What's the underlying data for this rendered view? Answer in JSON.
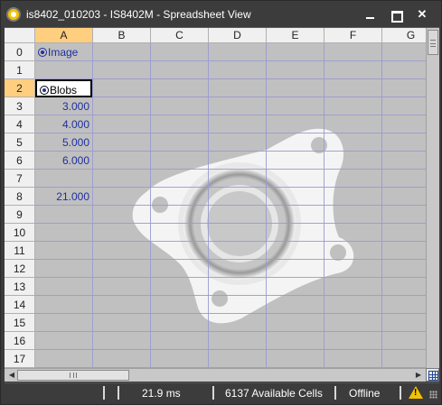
{
  "window": {
    "title": "is8402_010203 - IS8402M - Spreadsheet View"
  },
  "columns": [
    "A",
    "B",
    "C",
    "D",
    "E",
    "F",
    "G"
  ],
  "selected_column": "A",
  "rows": [
    "0",
    "1",
    "2",
    "3",
    "4",
    "5",
    "6",
    "7",
    "8",
    "9",
    "10",
    "11",
    "12",
    "13",
    "14",
    "15",
    "16",
    "17"
  ],
  "selected_row": "2",
  "cells": {
    "A0": "Image",
    "A2": "Blobs",
    "A3": "3.000",
    "A4": "4.000",
    "A5": "5.000",
    "A6": "6.000",
    "A8": "21.000"
  },
  "status": {
    "timing": "21.9 ms",
    "available_cells": "6137 Available Cells",
    "connection": "Offline"
  },
  "icons": {
    "app": "camera-app-icon",
    "minimize": "minimize-icon",
    "maximize": "maximize-icon",
    "close": "close-icon",
    "warning": "warning-icon",
    "grid_toggle": "grid-icon"
  },
  "colors": {
    "selection_header": "#ffcf7f",
    "cell_text": "#1f2f9f",
    "title_bar": "#3c3c3c",
    "warning": "#f2c200"
  }
}
